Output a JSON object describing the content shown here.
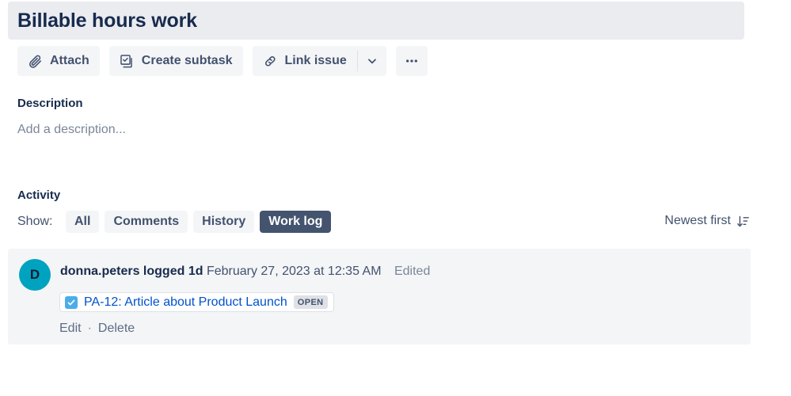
{
  "header": {
    "title": "Billable hours work"
  },
  "toolbar": {
    "attach_label": "Attach",
    "attach_icon": "paperclip-icon",
    "create_subtask_label": "Create subtask",
    "create_subtask_icon": "checkbox-stack-icon",
    "link_issue_label": "Link issue",
    "link_issue_icon": "chain-link-icon",
    "dropdown_icon": "chevron-down-icon",
    "more_icon": "ellipsis-icon"
  },
  "description": {
    "heading": "Description",
    "placeholder": "Add a description..."
  },
  "activity": {
    "heading": "Activity",
    "show_label": "Show:",
    "filters": [
      {
        "label": "All",
        "active": false
      },
      {
        "label": "Comments",
        "active": false
      },
      {
        "label": "History",
        "active": false
      },
      {
        "label": "Work log",
        "active": true
      }
    ],
    "sort": {
      "label": "Newest first",
      "icon": "sort-descending-icon"
    },
    "entries": [
      {
        "avatar_initial": "D",
        "avatar_color": "#00A3BF",
        "author": "donna.peters",
        "logged_label": "logged",
        "duration": "1d",
        "timestamp": "February 27, 2023 at 12:35 AM",
        "edited_label": "Edited",
        "issue": {
          "icon": "task-checkbox-icon",
          "key_and_summary": "PA-12: Article about Product Launch",
          "status": "OPEN"
        },
        "actions": {
          "edit_label": "Edit",
          "separator": "·",
          "delete_label": "Delete"
        }
      }
    ]
  },
  "colors": {
    "accent_link": "#0052CC",
    "selected_filter_bg": "#44546F",
    "avatar_bg": "#00A3BF",
    "card_bg": "#F4F5F7",
    "title_band_bg": "#EBECF0"
  }
}
